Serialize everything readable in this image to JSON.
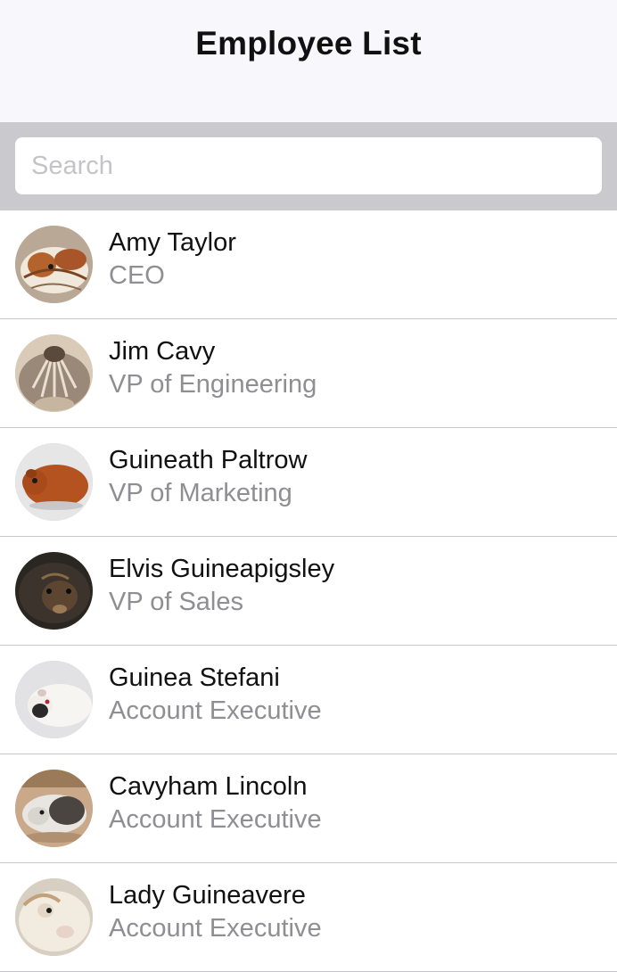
{
  "header": {
    "title": "Employee List"
  },
  "search": {
    "placeholder": "Search",
    "value": ""
  },
  "employees": [
    {
      "name": "Amy Taylor",
      "title": "CEO",
      "avatar": "guinea-pig-photo"
    },
    {
      "name": "Jim Cavy",
      "title": "VP of Engineering",
      "avatar": "guinea-pig-photo"
    },
    {
      "name": "Guineath Paltrow",
      "title": "VP of Marketing",
      "avatar": "guinea-pig-photo"
    },
    {
      "name": "Elvis Guineapigsley",
      "title": "VP of Sales",
      "avatar": "guinea-pig-photo"
    },
    {
      "name": "Guinea Stefani",
      "title": "Account Executive",
      "avatar": "guinea-pig-photo"
    },
    {
      "name": "Cavyham Lincoln",
      "title": "Account Executive",
      "avatar": "guinea-pig-photo"
    },
    {
      "name": "Lady Guineavere",
      "title": "Account Executive",
      "avatar": "guinea-pig-photo"
    }
  ]
}
